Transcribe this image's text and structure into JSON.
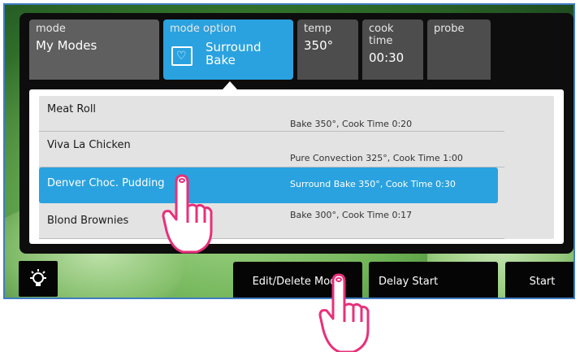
{
  "tabs": {
    "mode": {
      "label": "mode",
      "value": "My Modes"
    },
    "mode_option": {
      "label": "mode option",
      "value_line1": "Surround",
      "value_line2": "Bake"
    },
    "temp": {
      "label": "temp",
      "value": "350°"
    },
    "cook_time": {
      "label": "cook time",
      "value": "00:30"
    },
    "probe": {
      "label": "probe"
    }
  },
  "recipes": [
    {
      "name": "Meat Roll",
      "desc": "Bake 350°, Cook Time  0:20"
    },
    {
      "name": "Viva La Chicken",
      "desc": "Pure Convection 325°, Cook Time  1:00"
    },
    {
      "name": "Denver  Choc. Pudding",
      "desc": "Surround Bake 350°, Cook Time  0:30",
      "selected": true
    },
    {
      "name": "Blond Brownies",
      "desc": "Bake 300°, Cook Time  0:17"
    }
  ],
  "buttons": {
    "edit_delete": "Edit/Delete Mode",
    "delay_start": "Delay Start",
    "start": "Start"
  },
  "colors": {
    "accent": "#2aa2df",
    "frame_border": "#3f7cc2",
    "hand": "#e8307a"
  },
  "icons": {
    "light": "bulb-icon",
    "option": "heart-box-icon"
  }
}
